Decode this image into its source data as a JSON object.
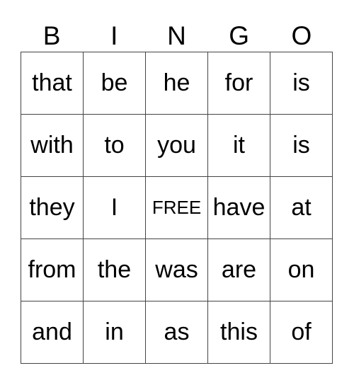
{
  "header": [
    "B",
    "I",
    "N",
    "G",
    "O"
  ],
  "rows": [
    [
      "that",
      "be",
      "he",
      "for",
      "is"
    ],
    [
      "with",
      "to",
      "you",
      "it",
      "is"
    ],
    [
      "they",
      "I",
      "FREE",
      "have",
      "at"
    ],
    [
      "from",
      "the",
      "was",
      "are",
      "on"
    ],
    [
      "and",
      "in",
      "as",
      "this",
      "of"
    ]
  ]
}
